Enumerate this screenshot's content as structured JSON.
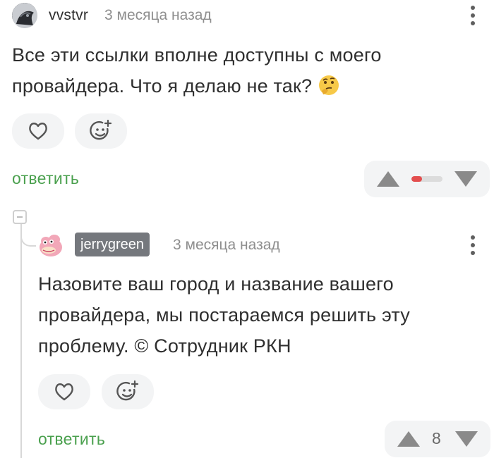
{
  "comment1": {
    "username": "vvstvr",
    "time": "3 месяца назад",
    "text_line1": "Все эти ссылки вполне доступны с моего",
    "text_line2": "провайдера. Что я делаю не так?",
    "emoji": "🤔",
    "reply_label": "ответить",
    "rating_negative_fraction": 0.35
  },
  "comment2": {
    "username": "jerrygreen",
    "time": "3 месяца назад",
    "text_line1": "Назовите ваш город и название вашего",
    "text_line2": "провайдера, мы постараемся решить эту",
    "text_line3": "проблему. © Сотрудник РКН",
    "reply_label": "ответить",
    "score": "8"
  },
  "icons": {
    "like": "heart-icon",
    "react": "smile-plus-icon",
    "menu": "more-vertical-icon",
    "upvote": "triangle-up-icon",
    "downvote": "triangle-down-icon",
    "collapse": "minus-square-icon"
  },
  "colors": {
    "reply": "#4aa04e",
    "badge_bg": "#75787d",
    "rating_negative": "#e34e4e",
    "pill_bg": "#f3f4f5"
  }
}
